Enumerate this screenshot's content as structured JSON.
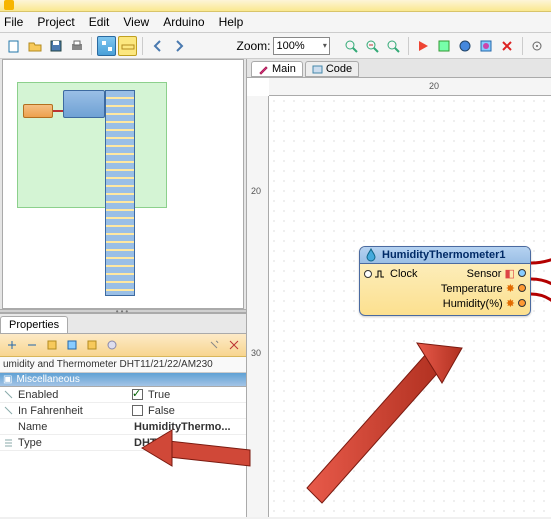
{
  "menubar": {
    "items": [
      "File",
      "Project",
      "Edit",
      "View",
      "Arduino",
      "Help"
    ]
  },
  "zoom": {
    "label": "Zoom:",
    "value": "100%"
  },
  "canvas": {
    "tabs": [
      {
        "icon": "pencil",
        "label": "Main"
      },
      {
        "icon": "code",
        "label": "Code"
      }
    ],
    "ruler_h": [
      "20"
    ],
    "ruler_v": [
      "20",
      "30"
    ]
  },
  "component": {
    "title": "HumidityThermometer1",
    "pins": {
      "in": [
        {
          "label": "Clock"
        }
      ],
      "out": [
        {
          "label": "Sensor"
        },
        {
          "label": "Temperature"
        },
        {
          "label": "Humidity(%)"
        }
      ]
    }
  },
  "properties": {
    "tab": "Properties",
    "title": "umidity and Thermometer DHT11/21/22/AM230",
    "category": "Miscellaneous",
    "rows": [
      {
        "name": "Enabled",
        "type": "bool",
        "checked": true,
        "value": "True"
      },
      {
        "name": "In Fahrenheit",
        "type": "bool",
        "checked": false,
        "value": "False"
      },
      {
        "name": "Name",
        "type": "text",
        "value": "HumidityThermo..."
      },
      {
        "name": "Type",
        "type": "text",
        "value": "DHT21"
      }
    ]
  }
}
